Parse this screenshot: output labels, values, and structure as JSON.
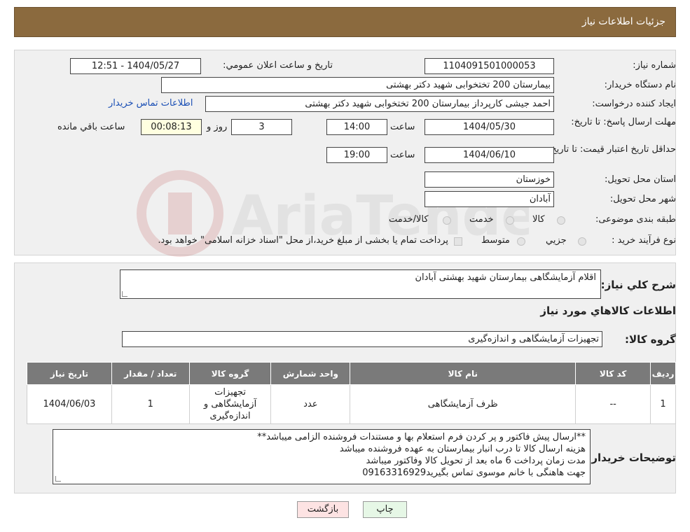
{
  "header": {
    "title": "جزئیات اطلاعات نیاز"
  },
  "form": {
    "need_number_label": "شماره نیاز:",
    "need_number": "1104091501000053",
    "announce_label": "تاریخ و ساعت اعلان عمومي:",
    "announce_value": "1404/05/27 - 12:51",
    "buyer_org_label": "نام دستگاه خريدار:",
    "buyer_org": "بیمارستان 200 تختخوابی شهید دکتر بهشتی",
    "creator_label": "ايجاد کننده درخواست:",
    "creator": "احمد جیشی کارپرداز بیمارستان 200 تختخوابی شهید دکتر بهشتی",
    "contact_link": "اطلاعات تماس خريدار",
    "deadline_label": "مهلت ارسال پاسخ: تا تاریخ:",
    "deadline_date": "1404/05/30",
    "time_label": "ساعت",
    "deadline_time": "14:00",
    "days_value": "3",
    "days_label": "روز و",
    "remaining_value": "00:08:13",
    "remaining_label": "ساعت باقي مانده",
    "validity_label": "حداقل تاريخ اعتبار قيمت: تا تاريخ:",
    "validity_date": "1404/06/10",
    "validity_time": "19:00",
    "province_label": "استان محل تحويل:",
    "province": "خوزستان",
    "city_label": "شهر محل تحويل:",
    "city": "آبادان",
    "category_label": "طبقه بندی موضوعی:",
    "category_options": [
      "کالا",
      "خدمت",
      "کالا/خدمت"
    ],
    "purchase_type_label": "نوع فرآيند خريد :",
    "purchase_options": [
      "جزیي",
      "متوسط"
    ],
    "purchase_note": "پرداخت تمام يا بخشی از مبلغ خريد،از محل \"اسناد خزانه اسلامی\" خواهد بود."
  },
  "summary": {
    "desc_label": "شرح كلي نياز:",
    "desc_value": "اقلام آزمایشگاهی بیمارستان شهید بهشتی آبادان",
    "items_title": "اطلاعات كالاهاي مورد نياز",
    "group_label": "گروه كالا:",
    "group_value": "تجهیزات آزمایشگاهی و اندازه‌گیری"
  },
  "table": {
    "headers": [
      "رديف",
      "كد كالا",
      "نام كالا",
      "واحد شمارش",
      "گروه كالا",
      "تعداد / مقدار",
      "تاريخ نياز"
    ],
    "row": {
      "index": "1",
      "code": "--",
      "name": "ظرف آزمایشگاهی",
      "unit": "عدد",
      "group": "تجهیزات آزمایشگاهی و اندازه‌گیری",
      "qty": "1",
      "date": "1404/06/03"
    }
  },
  "notes": {
    "label": "توضيحات خريدار:",
    "lines": [
      "**ارسال پیش فاکتور و پر کردن فرم استعلام بها  و مستندات فروشنده الزامی میباشد**",
      "هزینه ارسال کالا تا درب انبار بیمارستان به عهده فروشنده میباشد",
      "مدت زمان پرداخت 6 ماه بعد از تحویل کالا وفاکتور میباشد",
      "جهت هاهنگی با خانم موسوی تماس بگیرید09163316929"
    ]
  },
  "buttons": {
    "print": "چاپ",
    "back": "بازگشت"
  },
  "colors": {
    "header_bg": "#8b6a3e",
    "table_header_bg": "#7a7a7a",
    "back_btn_bg": "#fde3e3",
    "print_btn_bg": "#e6f7e6"
  }
}
